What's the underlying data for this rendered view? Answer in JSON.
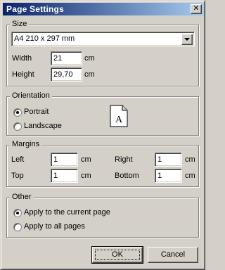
{
  "window": {
    "title": "Page Settings",
    "close_glyph": "✕"
  },
  "size": {
    "legend": "Size",
    "paper_value": "A4 210 x 297 mm",
    "width_label": "Width",
    "width_value": "21",
    "width_unit": "cm",
    "height_label": "Height",
    "height_value": "29,70",
    "height_unit": "cm"
  },
  "orientation": {
    "legend": "Orientation",
    "portrait_label": "Portrait",
    "landscape_label": "Landscape",
    "selected": "Portrait",
    "preview_letter": "A"
  },
  "margins": {
    "legend": "Margins",
    "left_label": "Left",
    "left_value": "1",
    "left_unit": "cm",
    "right_label": "Right",
    "right_value": "1",
    "right_unit": "cm",
    "top_label": "Top",
    "top_value": "1",
    "top_unit": "cm",
    "bottom_label": "Bottom",
    "bottom_value": "1",
    "bottom_unit": "cm"
  },
  "other": {
    "legend": "Other",
    "current_label": "Apply to the current page",
    "all_label": "Apply to all pages",
    "selected": "Apply to the current page"
  },
  "buttons": {
    "ok": "OK",
    "cancel": "Cancel"
  },
  "colors": {
    "face": "#d4d0c8",
    "title_start": "#0a246a",
    "title_end": "#a6caf0"
  }
}
